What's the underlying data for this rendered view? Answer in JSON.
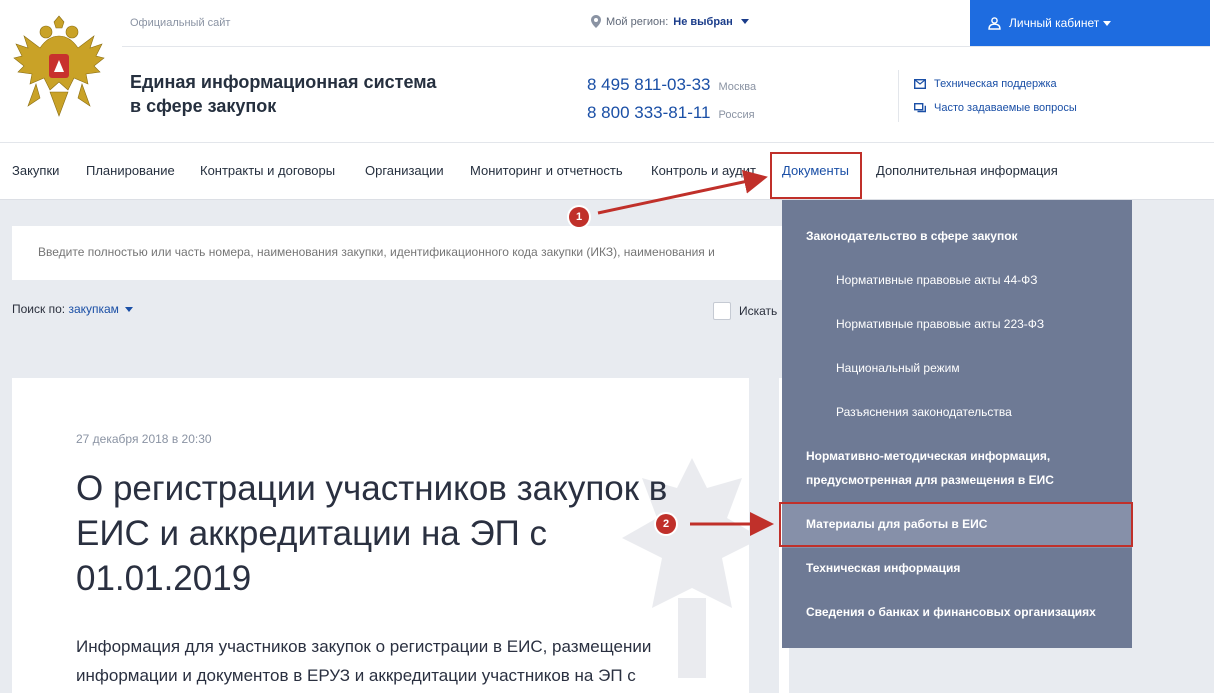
{
  "header": {
    "official_label": "Официальный сайт",
    "region_label": "Мой регион:",
    "region_value": "Не выбран",
    "cabinet_label": "Личный кабинет",
    "site_title": "Единая информационная система в сфере закупок",
    "phones": [
      {
        "number": "8 495 811-03-33",
        "note": "Москва"
      },
      {
        "number": "8 800 333-81-11",
        "note": "Россия"
      }
    ],
    "links": {
      "support": "Техническая поддержка",
      "faq": "Часто задаваемые вопросы"
    }
  },
  "nav": {
    "items": [
      "Закупки",
      "Планирование",
      "Контракты и договоры",
      "Организации",
      "Мониторинг и отчетность",
      "Контроль и аудит",
      "Документы",
      "Дополнительная информация"
    ]
  },
  "search": {
    "placeholder": "Введите полностью или часть номера, наименования закупки, идентификационного кода закупки (ИКЗ), наименования и",
    "by_label": "Поиск по:",
    "by_value": "закупкам",
    "checkbox_label": "Искать"
  },
  "article": {
    "date": "27 декабря 2018 в 20:30",
    "title": "О регистрации участников закупок в ЕИС и аккредитации на ЭП с 01.01.2019",
    "text": "Информация для участников закупок о регистрации в ЕИС, размещении информации и документов в ЕРУЗ и аккредитации участников на ЭП с"
  },
  "dropdown": {
    "items": [
      "Законодательство в сфере закупок",
      "Нормативные правовые акты 44-ФЗ",
      "Нормативные правовые акты 223-ФЗ",
      "Национальный режим",
      "Разъяснения законодательства",
      "Нормативно-методическая информация, предусмотренная для размещения в ЕИС",
      "Материалы для работы в ЕИС",
      "Техническая информация",
      "Сведения о банках и финансовых организациях"
    ]
  },
  "markers": [
    "1",
    "2"
  ],
  "colors": {
    "accent": "#1e6ce0",
    "link": "#1a4fa6",
    "dropdown_bg": "#6e7a95",
    "highlight": "#c0302a"
  }
}
